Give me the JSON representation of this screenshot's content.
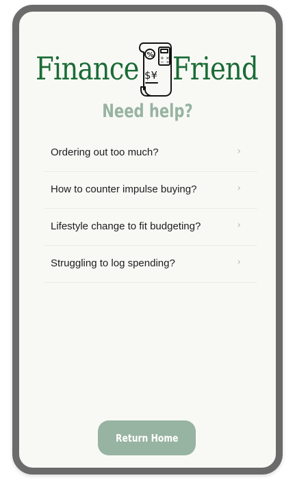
{
  "app": {
    "title_left": "Finance",
    "title_right": "Friend",
    "brand_color": "#1a6b35"
  },
  "header": {
    "subtitle": "Need help?",
    "accent_color": "#97b3a1"
  },
  "help_topics": [
    {
      "label": "Ordering out too much?",
      "icon": "chevron-right-icon"
    },
    {
      "label": "How to counter impulse buying?",
      "icon": "chevron-right-icon"
    },
    {
      "label": "Lifestyle change to fit budgeting?",
      "icon": "chevron-right-icon"
    },
    {
      "label": "Struggling to log spending?",
      "icon": "chevron-right-icon"
    }
  ],
  "footer": {
    "return_label": "Return Home"
  }
}
